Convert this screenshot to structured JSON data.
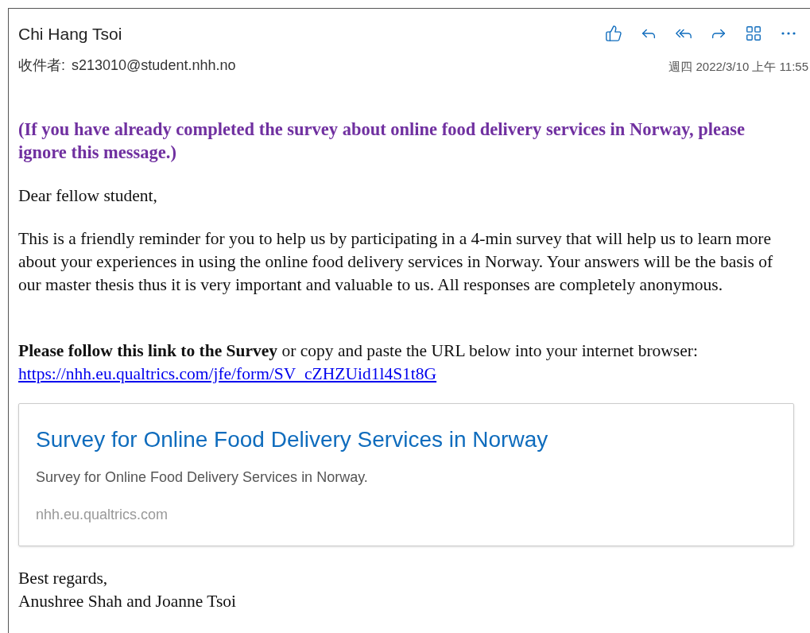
{
  "header": {
    "sender": "Chi Hang Tsoi",
    "recipient_label": "收件者:",
    "recipient": "s213010@student.nhh.no",
    "date": "週四 2022/3/10 上午 11:55"
  },
  "toolbar": [
    {
      "kind": "like"
    },
    {
      "kind": "reply"
    },
    {
      "kind": "reply_all"
    },
    {
      "kind": "forward"
    },
    {
      "kind": "apps"
    },
    {
      "kind": "more"
    }
  ],
  "body": {
    "notice": "(If you have already completed the survey about online food delivery services in Norway, please ignore this message.)",
    "greeting": "Dear fellow student,",
    "paragraph": "This is a friendly reminder for you to help us by participating in a 4-min survey that will help us to learn more about your experiences in using the online food delivery services in Norway. Your answers will be the basis of our master thesis thus it is very important and valuable to us. All responses are completely anonymous.",
    "instruction": "**Please follow this link to the Survey** or copy and paste the URL below into your internet browser:",
    "link": "https://nhh.eu.qualtrics.com/jfe/form/SV_cZHZUid1l4S1t8G",
    "preview": {
      "title": "Survey for Online Food Delivery Services in Norway",
      "description": "Survey for Online Food Delivery Services in Norway.",
      "domain": "nhh.eu.qualtrics.com"
    },
    "closing": "Best regards,",
    "signature": "Anushree Shah and Joanne Tsoi"
  }
}
